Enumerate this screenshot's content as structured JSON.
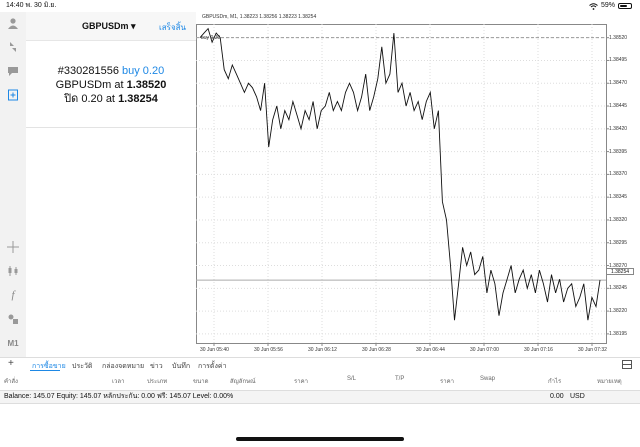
{
  "status_bar": {
    "time": "14:40",
    "date": "พ. 30 มิ.ย.",
    "battery": "59%",
    "battery_level": 0.59
  },
  "order_panel": {
    "symbol": "GBPUSDm",
    "done_label": "เสร็จสิ้น",
    "ticket": "#330281556",
    "side": "buy 0.20",
    "line2_prefix": "GBPUSDm at",
    "open_price": "1.38520",
    "line3_prefix": "ปิด 0.20 at",
    "close_price": "1.38254"
  },
  "chart": {
    "title": "GBPUSDm, M1, 1.38223 1.38256 1.38223 1.38254",
    "volume_label": "buy 0.20",
    "current_price": "1.38254",
    "price_labels": [
      "1.38520",
      "1.38495",
      "1.38470",
      "1.38445",
      "1.38420",
      "1.38395",
      "1.38370",
      "1.38345",
      "1.38320",
      "1.38295",
      "1.38270",
      "1.38245",
      "1.38220",
      "1.38195"
    ],
    "time_labels": [
      "30 Jun 05:40",
      "30 Jun 05:56",
      "30 Jun 06:12",
      "30 Jun 06:28",
      "30 Jun 06:44",
      "30 Jun 07:00",
      "30 Jun 07:16",
      "30 Jun 07:32"
    ]
  },
  "chart_data": {
    "type": "line",
    "title": "GBPUSDm, M1, 1.38223 1.38256 1.38223 1.38254",
    "xlabel": "",
    "ylabel": "",
    "ylim": [
      1.38185,
      1.38535
    ],
    "x": [
      "30 Jun 05:40",
      "30 Jun 05:56",
      "30 Jun 06:12",
      "30 Jun 06:28",
      "30 Jun 06:44",
      "30 Jun 07:00",
      "30 Jun 07:16",
      "30 Jun 07:32"
    ],
    "series": [
      {
        "values": [
          1.3852,
          1.38525,
          1.3853,
          1.38515,
          1.38525,
          1.3852,
          1.38485,
          1.38475,
          1.3849,
          1.3848,
          1.3847,
          1.3846,
          1.3847,
          1.38465,
          1.38455,
          1.3844,
          1.3847,
          1.384,
          1.3843,
          1.38445,
          1.3842,
          1.3844,
          1.3843,
          1.3845,
          1.38435,
          1.3842,
          1.3844,
          1.3843,
          1.3845,
          1.3842,
          1.3844,
          1.38445,
          1.3846,
          1.3844,
          1.3845,
          1.3844,
          1.3846,
          1.3847,
          1.3846,
          1.3844,
          1.38455,
          1.3848,
          1.3844,
          1.38455,
          1.38475,
          1.3851,
          1.3847,
          1.3848,
          1.38525,
          1.3846,
          1.3847,
          1.38445,
          1.3846,
          1.3844,
          1.3845,
          1.3843,
          1.3845,
          1.3846,
          1.3842,
          1.3844,
          1.3834,
          1.3832,
          1.3827,
          1.3821,
          1.3825,
          1.3829,
          1.3827,
          1.38285,
          1.3826,
          1.38265,
          1.3828,
          1.3824,
          1.38265,
          1.3825,
          1.38215,
          1.3824,
          1.38255,
          1.3827,
          1.3824,
          1.38255,
          1.38265,
          1.38245,
          1.3826,
          1.3824,
          1.38265,
          1.3825,
          1.3823,
          1.3826,
          1.3824,
          1.38255,
          1.3823,
          1.38245,
          1.3825,
          1.38225,
          1.38235,
          1.3825,
          1.3821,
          1.38235,
          1.38225,
          1.38254
        ]
      }
    ]
  },
  "tabs": [
    "การซื้อขาย",
    "ประวัติ",
    "กล่องจดหมาย",
    "ข่าว",
    "บันทึก",
    "การตั้งค่า"
  ],
  "columns": [
    "คำสั่ง",
    "เวลา",
    "ประเภท",
    "ขนาด",
    "สัญลักษณ์",
    "ราคา",
    "S/L",
    "T/P",
    "ราคา",
    "Swap",
    "กำไร",
    "หมายเหตุ"
  ],
  "balance": {
    "summary": "Balance: 145.07 Equity: 145.07 หลักประกัน: 0.00 ฟรี: 145.07 Level: 0.00%",
    "profit": "0.00",
    "currency": "USD"
  },
  "left_toolbar": {
    "m1_label": "M1"
  },
  "colors": {
    "accent": "#1e88e5",
    "line": "#111111"
  }
}
